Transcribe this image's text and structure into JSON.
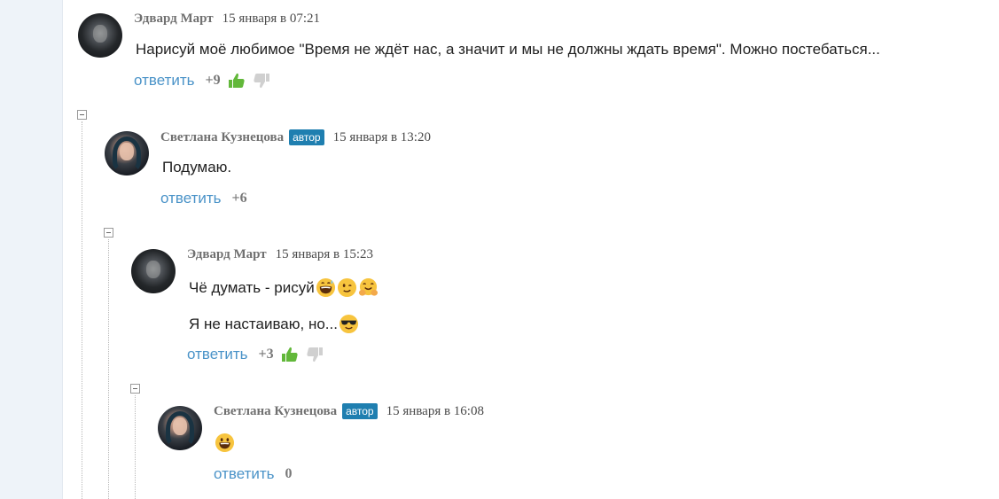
{
  "comments": [
    {
      "author": "Эдвард Март",
      "date": "15 января в 07:21",
      "text": "Нарисуй моё любимое \"Время не ждёт нас, а значит и мы не должны ждать время\". Можно постебаться...",
      "reply_label": "ответить",
      "score": "+9",
      "avatar": "edward-avatar"
    },
    {
      "author": "Светлана Кузнецова",
      "badge": "автор",
      "date": "15 января в 13:20",
      "text": "Подумаю.",
      "reply_label": "ответить",
      "score": "+6",
      "avatar": "svetlana-avatar"
    },
    {
      "author": "Эдвард Март",
      "date": "15 января в 15:23",
      "text": "Чё думать - рисуй",
      "text_emojis": [
        "grinning-sweat-emoji",
        "winking-emoji",
        "hugging-emoji"
      ],
      "text2": "Я не настаиваю, но...",
      "text2_emojis": [
        "sunglasses-emoji"
      ],
      "reply_label": "ответить",
      "score": "+3",
      "avatar": "edward-avatar"
    },
    {
      "author": "Светлана Кузнецова",
      "badge": "автор",
      "date": "15 января в 16:08",
      "text_emojis": [
        "grinning-emoji"
      ],
      "reply_label": "ответить",
      "score": "0",
      "avatar": "svetlana-avatar"
    }
  ],
  "icons": {
    "like": "thumbs-up-icon",
    "dislike": "thumbs-down-icon",
    "collapse": "collapse-minus-icon"
  },
  "colors": {
    "reply_link": "#4a93c8",
    "badge": "#1f7fb0",
    "like": "#62b83a",
    "dislike": "#d0d0d0"
  }
}
